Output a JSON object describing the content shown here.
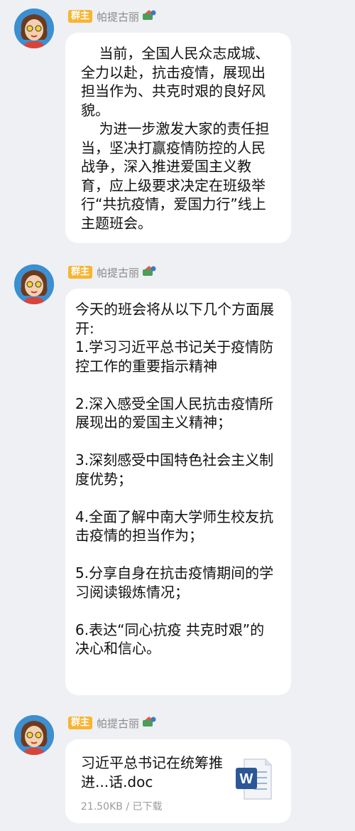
{
  "messages": [
    {
      "role_badge": "群主",
      "sender": "帕提古丽",
      "paragraphs": [
        "    当前，全国人民众志成城、全力以赴，抗击疫情，展现出担当作为、共克时艰的良好风貌。",
        "    为进一步激发大家的责任担当，坚决打赢疫情防控的人民战争，深入推进爱国主义教育，应上级要求决定在班级举行“共抗疫情，爱国力行”线上主题班会。"
      ]
    },
    {
      "role_badge": "群主",
      "sender": "帕提古丽",
      "paragraphs": [
        "今天的班会将从以下几个方面展开:",
        "1.学习习近平总书记关于疫情防控工作的重要指示精神",
        "",
        "2.深入感受全国人民抗击疫情所展现出的爱国主义精神；",
        "",
        "3.深刻感受中国特色社会主义制度优势；",
        "",
        "4.全面了解中南大学师生校友抗击疫情的担当作为；",
        "",
        "5.分享自身在抗击疫情期间的学习阅读锻炼情况；",
        "",
        "6.表达“同心抗疫 共克时艰”的决心和信心。"
      ]
    },
    {
      "role_badge": "群主",
      "sender": "帕提古丽",
      "file": {
        "name": "习近平总书记在统筹推进...话.doc",
        "size": "21.50KB",
        "separator": " / ",
        "status": "已下载",
        "icon": "word-doc-icon",
        "icon_letter": "W"
      }
    }
  ],
  "colors": {
    "background": "#eef0f3",
    "bubble": "#ffffff",
    "badge": "#f9b431",
    "sender": "#8a8a8a",
    "word_blue": "#2b5797"
  }
}
